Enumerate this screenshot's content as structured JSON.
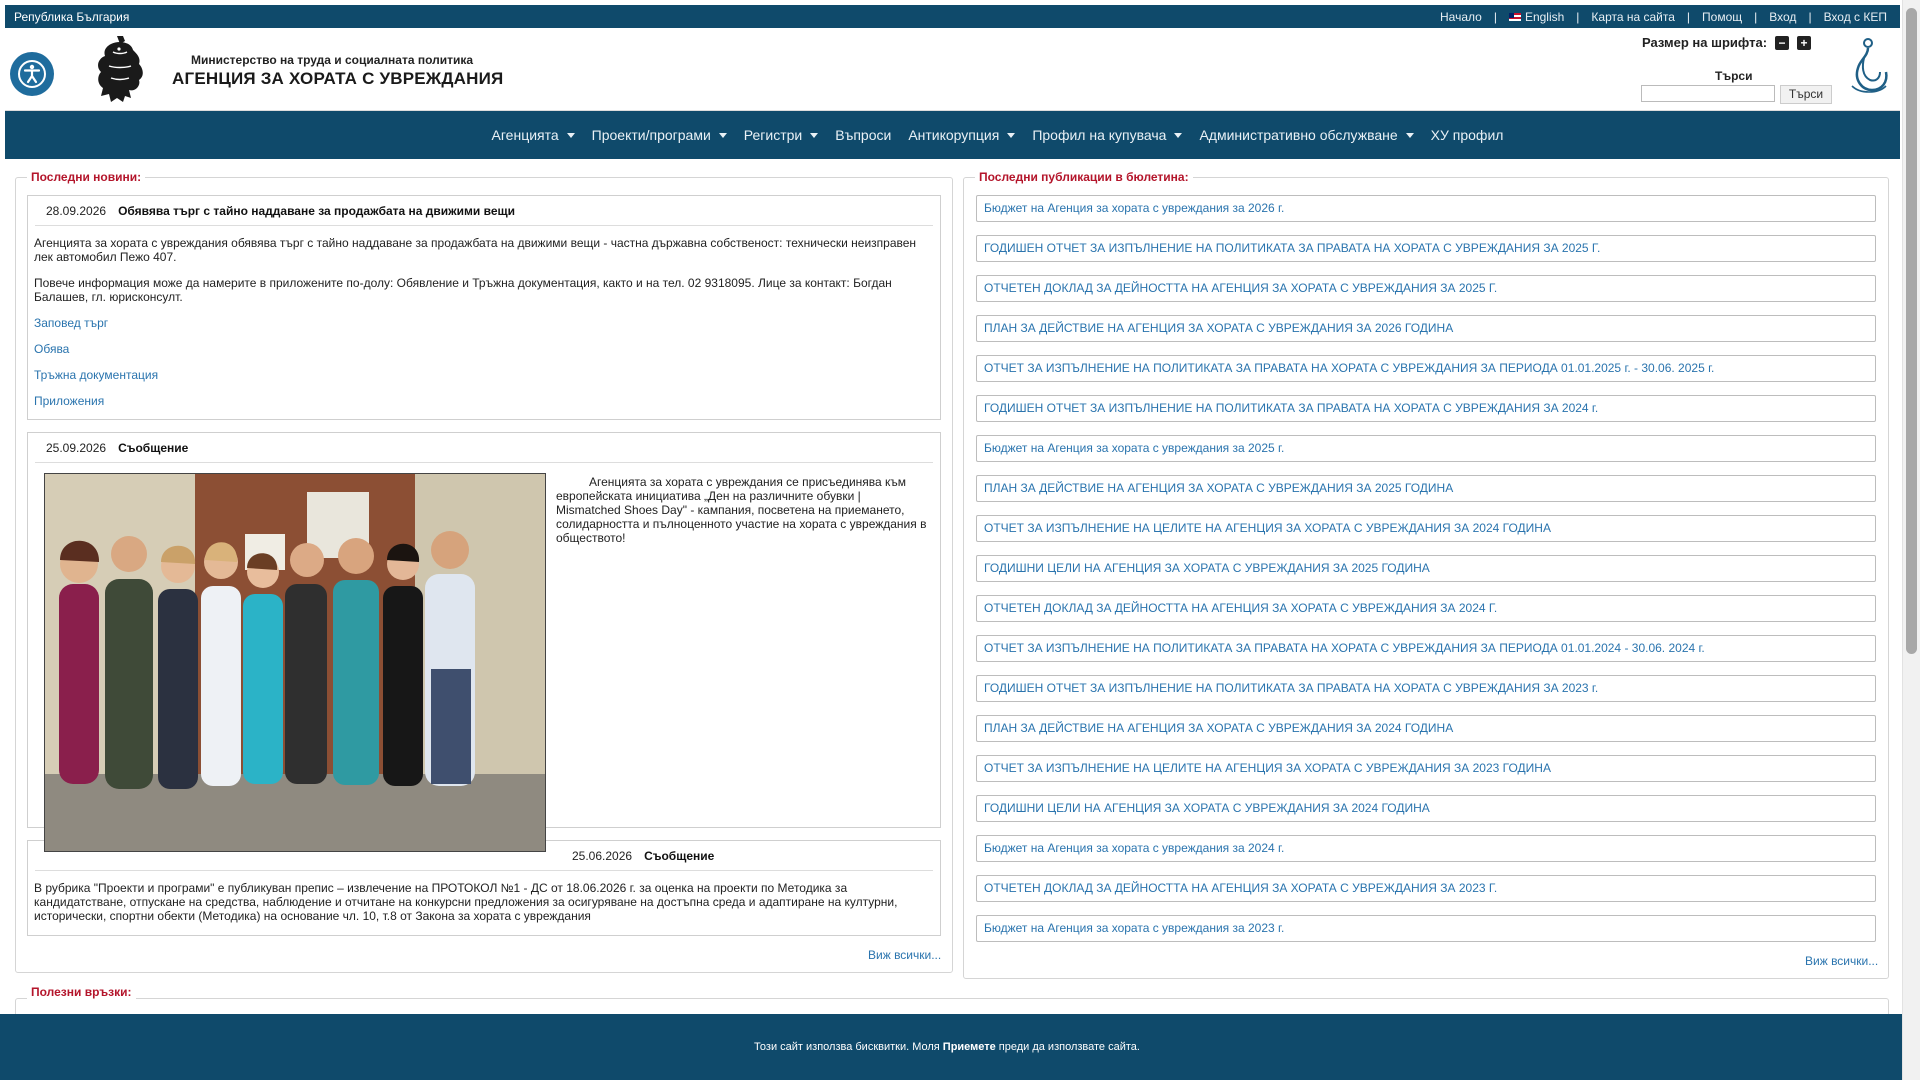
{
  "topbar": {
    "country": "Република България",
    "links": [
      "Начало",
      "English",
      "Карта на сайта",
      "Помощ",
      "Вход",
      "Вход с КЕП"
    ],
    "separator": "|"
  },
  "header": {
    "ministry": "Министерство на труда и социалната политика",
    "agency": "АГЕНЦИЯ ЗА ХОРАТА С УВРЕЖДАНИЯ",
    "font_size_label": "Размер на шрифта:",
    "font_minus": "−",
    "font_plus": "+",
    "search_label": "Търси",
    "search_button": "Търси",
    "search_value": ""
  },
  "nav": [
    "Агенцията",
    "Проекти/програми",
    "Регистри",
    "Въпроси",
    "Антикорупция",
    "Профил на купувача",
    "Административно обслужване",
    "ХУ профил"
  ],
  "nav_dropdown": [
    true,
    true,
    true,
    false,
    true,
    true,
    true,
    false
  ],
  "news": {
    "legend": "Последни новини:",
    "view_all": "Виж всички...",
    "item1": {
      "date": "28.09.2026",
      "title": "Обявява търг с тайно наддаване за продажбата на движими вещи",
      "p1": "Агенцията за хората с увреждания обявява търг с тайно наддаване за продажбата на движими вещи - частна държавна собственост: технически неизправен лек автомобил Пежо 407.",
      "p2": "Повече  информация може да намерите в приложените по-долу: Обявление и Тръжна документация, както и на тел. 02 9318095. Лице за контакт: Богдан Балашев, гл. юрисконсулт.",
      "links": [
        "Заповед търг",
        "Обява",
        "Тръжна документация",
        "Приложения"
      ]
    },
    "item2": {
      "date": "25.09.2026",
      "title": "Съобщение",
      "text": "Агенцията за хората с увреждания се присъединява към европейската инициатива „Ден на различните обувки | Mismatched Shoes Day\" - кампания, посветена на приемането, солидарността и пълноценното участие на хората с увреждания в обществото!"
    },
    "item3": {
      "date": "25.06.2026",
      "title": "Съобщение",
      "text": "В рубрика \"Проекти и програми\" е публикуван препис – извлечение на ПРОТОКОЛ №1 - ДС от 18.06.2026 г. за оценка на проекти по Методика за кандидатстване, отпускане на средства, наблюдение и отчитане на конкурсни предложения за осигуряване на достъпна среда и адаптиране на културни, исторически, спортни обекти (Методика) на основание чл. 10, т.8 от Закона за хората с увреждания"
    }
  },
  "bulletin": {
    "legend": "Последни публикации в бюлетина:",
    "view_all": "Виж всички...",
    "items": [
      "Бюджет на Агенция за хората с увреждания за 2026 г.",
      "ГОДИШЕН ОТЧЕТ ЗА ИЗПЪЛНЕНИЕ НА ПОЛИТИКАТА ЗА ПРАВАТА НА ХОРАТА С УВРЕЖДАНИЯ ЗА 2025 Г.",
      "ОТЧЕТЕН ДОКЛАД ЗА ДЕЙНОСТТА НА АГЕНЦИЯ ЗА ХОРАТА С УВРЕЖДАНИЯ ЗА 2025 Г.",
      "ПЛАН ЗА ДЕЙСТВИЕ НА АГЕНЦИЯ ЗА ХОРАТА С УВРЕЖДАНИЯ ЗА 2026 ГОДИНА",
      "ОТЧЕТ ЗА ИЗПЪЛНЕНИЕ НА ПОЛИТИКАТА ЗА ПРАВАТА НА ХОРАТА С УВРЕЖДАНИЯ ЗА ПЕРИОДА 01.01.2025 г. - 30.06. 2025 г.",
      "ГОДИШЕН ОТЧЕТ ЗА ИЗПЪЛНЕНИЕ НА ПОЛИТИКАТА ЗА ПРАВАТА НА ХОРАТА С УВРЕЖДАНИЯ ЗА 2024 г.",
      "Бюджет на Агенция за хората с увреждания за 2025 г.",
      "ПЛАН ЗА ДЕЙСТВИЕ НА АГЕНЦИЯ ЗА ХОРАТА С УВРЕЖДАНИЯ ЗА 2025 ГОДИНА",
      "ОТЧЕТ ЗА ИЗПЪЛНЕНИЕ НА ЦЕЛИТЕ НА АГЕНЦИЯ ЗА ХОРАТА С УВРЕЖДАНИЯ ЗА 2024 ГОДИНА",
      "ГОДИШНИ ЦЕЛИ НА АГЕНЦИЯ ЗА ХОРАТА С УВРЕЖДАНИЯ ЗА 2025 ГОДИНА",
      "ОТЧЕТЕН ДОКЛАД ЗА ДЕЙНОСТТА НА АГЕНЦИЯ ЗА ХОРАТА С УВРЕЖДАНИЯ ЗА 2024 Г.",
      "ОТЧЕТ ЗА ИЗПЪЛНЕНИЕ НА ПОЛИТИКАТА ЗА ПРАВАТА НА ХОРАТА С УВРЕЖДАНИЯ ЗА ПЕРИОДА 01.01.2024 - 30.06. 2024 г.",
      "ГОДИШЕН ОТЧЕТ ЗА ИЗПЪЛНЕНИЕ НА ПОЛИТИКАТА ЗА ПРАВАТА НА ХОРАТА С УВРЕЖДАНИЯ ЗА 2023 г.",
      "ПЛАН ЗА ДЕЙСТВИЕ НА АГЕНЦИЯ ЗА ХОРАТА С УВРЕЖДАНИЯ ЗА 2024 ГОДИНА",
      "ОТЧЕТ ЗА ИЗПЪЛНЕНИЕ НА ЦЕЛИТЕ НА АГЕНЦИЯ ЗА ХОРАТА С УВРЕЖДАНИЯ ЗА 2023 ГОДИНА",
      "ГОДИШНИ ЦЕЛИ НА АГЕНЦИЯ ЗА ХОРАТА С УВРЕЖДАНИЯ ЗА 2024 ГОДИНА",
      "Бюджет на Агенция за хората с увреждания за 2024 г.",
      "ОТЧЕТЕН ДОКЛАД ЗА ДЕЙНОСТТА НА АГЕНЦИЯ ЗА ХОРАТА С УВРЕЖДАНИЯ ЗА 2023 Г.",
      "Бюджет на Агенция за хората с увреждания за 2023 г."
    ]
  },
  "useful_links": {
    "legend": "Полезни връзки:"
  },
  "cookie": {
    "before": "Този сайт използва бисквитки. Моля",
    "accept": "Приемете",
    "after": "преди да използвате сайта."
  },
  "colors": {
    "brand": "#0f4a6b",
    "legend": "#b4152b",
    "link": "#2a74ae"
  }
}
